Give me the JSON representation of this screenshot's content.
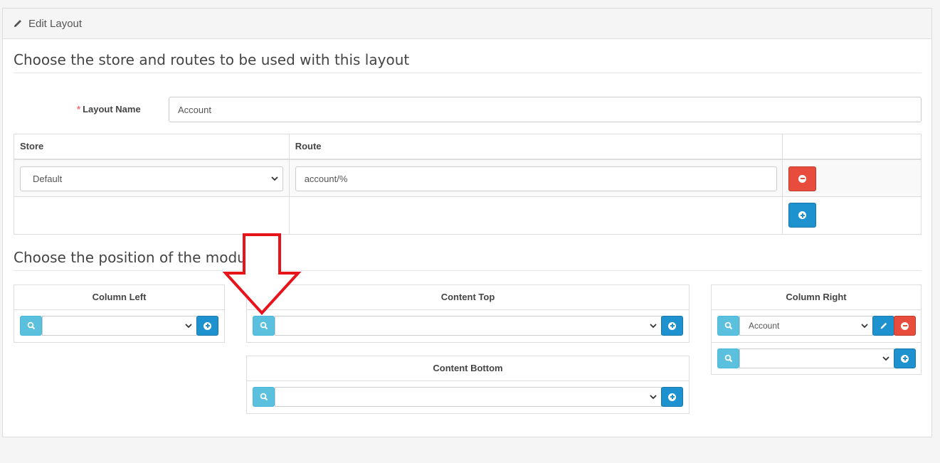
{
  "panel": {
    "title": "Edit Layout"
  },
  "section1": {
    "title": "Choose the store and routes to be used with this layout"
  },
  "layout_name": {
    "required_mark": "*",
    "label": "Layout Name",
    "value": "Account"
  },
  "routes_table": {
    "headers": {
      "store": "Store",
      "route": "Route"
    },
    "rows": [
      {
        "store": "Default",
        "route": "account/%"
      }
    ]
  },
  "section2": {
    "title": "Choose the position of the modules"
  },
  "modules": {
    "column_left": {
      "title": "Column Left",
      "selected": ""
    },
    "content_top": {
      "title": "Content Top",
      "selected": ""
    },
    "content_bottom": {
      "title": "Content Bottom",
      "selected": ""
    },
    "column_right": {
      "title": "Column Right",
      "items": [
        {
          "selected": "Account"
        }
      ],
      "new_selected": ""
    }
  },
  "colors": {
    "danger": "#e74c3c",
    "primary": "#1e91cf",
    "info": "#5bc0de",
    "annotation_arrow": "#e8141c"
  },
  "icons": {
    "heading": "pencil-icon",
    "remove": "minus-circle-icon",
    "add": "plus-circle-icon",
    "search": "search-icon",
    "edit": "pencil-icon",
    "dropdown": "chevron-down-icon"
  }
}
